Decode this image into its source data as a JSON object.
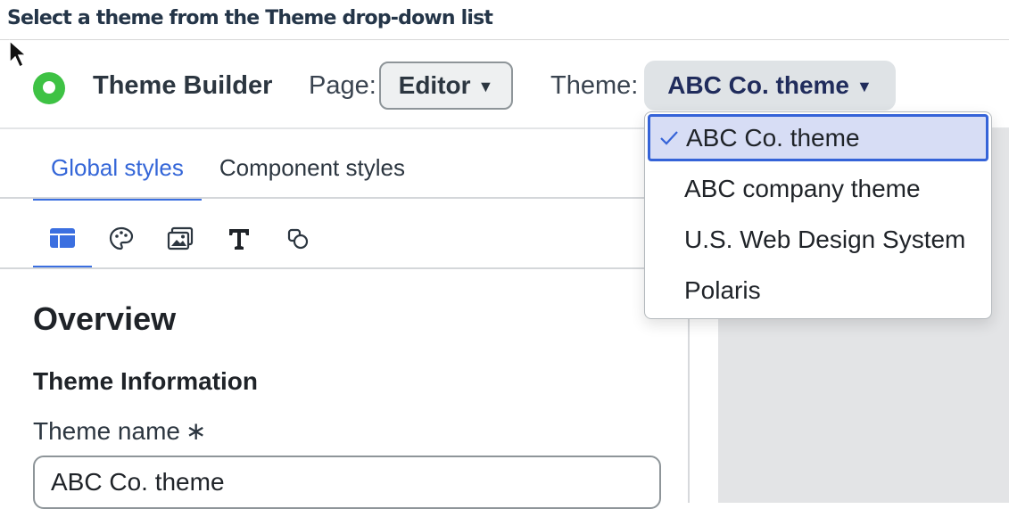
{
  "instruction": "Select a theme from the Theme drop-down list",
  "header": {
    "app_title": "Theme Builder",
    "page_label": "Page:",
    "page_value": "Editor",
    "theme_label": "Theme:",
    "theme_value": "ABC Co. theme"
  },
  "tabs": [
    {
      "label": "Global styles",
      "active": true
    },
    {
      "label": "Component styles",
      "active": false
    }
  ],
  "style_icons": [
    "layout-icon",
    "palette-icon",
    "image-icon",
    "typography-icon",
    "shapes-icon"
  ],
  "content": {
    "title": "Overview",
    "section_title": "Theme Information",
    "field_label": "Theme name",
    "required_marker": "∗",
    "field_value": "ABC Co. theme"
  },
  "theme_dropdown": {
    "options": [
      {
        "label": "ABC Co. theme",
        "selected": true
      },
      {
        "label": "ABC company theme",
        "selected": false
      },
      {
        "label": "U.S. Web Design System",
        "selected": false
      },
      {
        "label": "Polaris",
        "selected": false
      }
    ]
  },
  "colors": {
    "accent": "#3b6fe0",
    "logo": "#3ec244",
    "theme_button_text": "#202c5c",
    "selected_option_bg": "#d7ddf5"
  }
}
